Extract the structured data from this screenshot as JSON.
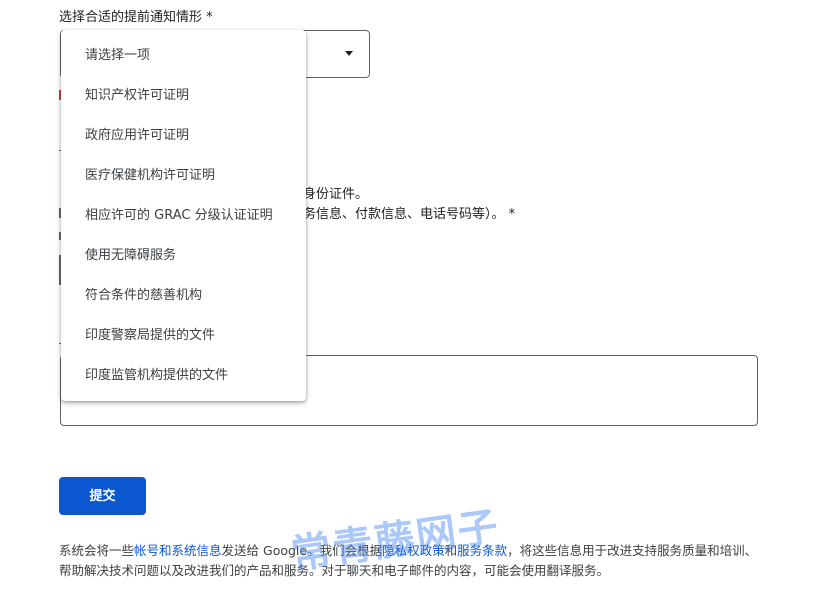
{
  "form": {
    "field_label": "选择合适的提前通知情形 *",
    "select_value": "",
    "partial_line_1": "或身份证件。",
    "partial_line_2": "财务信息、付款信息、电话号码等）。 *",
    "textarea_value": "",
    "submit_label": "提交"
  },
  "dropdown": {
    "options": [
      "请选择一项",
      "知识产权许可证明",
      "政府应用许可证明",
      "医疗保健机构许可证明",
      "相应许可的 GRAC 分级认证证明",
      "使用无障碍服务",
      "符合条件的慈善机构",
      "印度警察局提供的文件",
      "印度监管机构提供的文件"
    ]
  },
  "footer": {
    "text_1": "系统会将一些",
    "link_1": "帐号和系统信息",
    "text_2": "发送给 Google。",
    "text_3": "我们会根据",
    "link_2": "隐私权政策",
    "text_4": "和",
    "link_3": "服务条款",
    "text_5": "，将这些信息用于改进支持服务质量和培训、帮助解决技术问题以及改进我们的产品和服务。对于聊天和电子邮件的内容，可能会使用翻译服务。"
  },
  "watermark": "常青藤网子",
  "colors": {
    "primary": "#0b57d0",
    "error": "#d93025",
    "border": "#5f6368"
  }
}
